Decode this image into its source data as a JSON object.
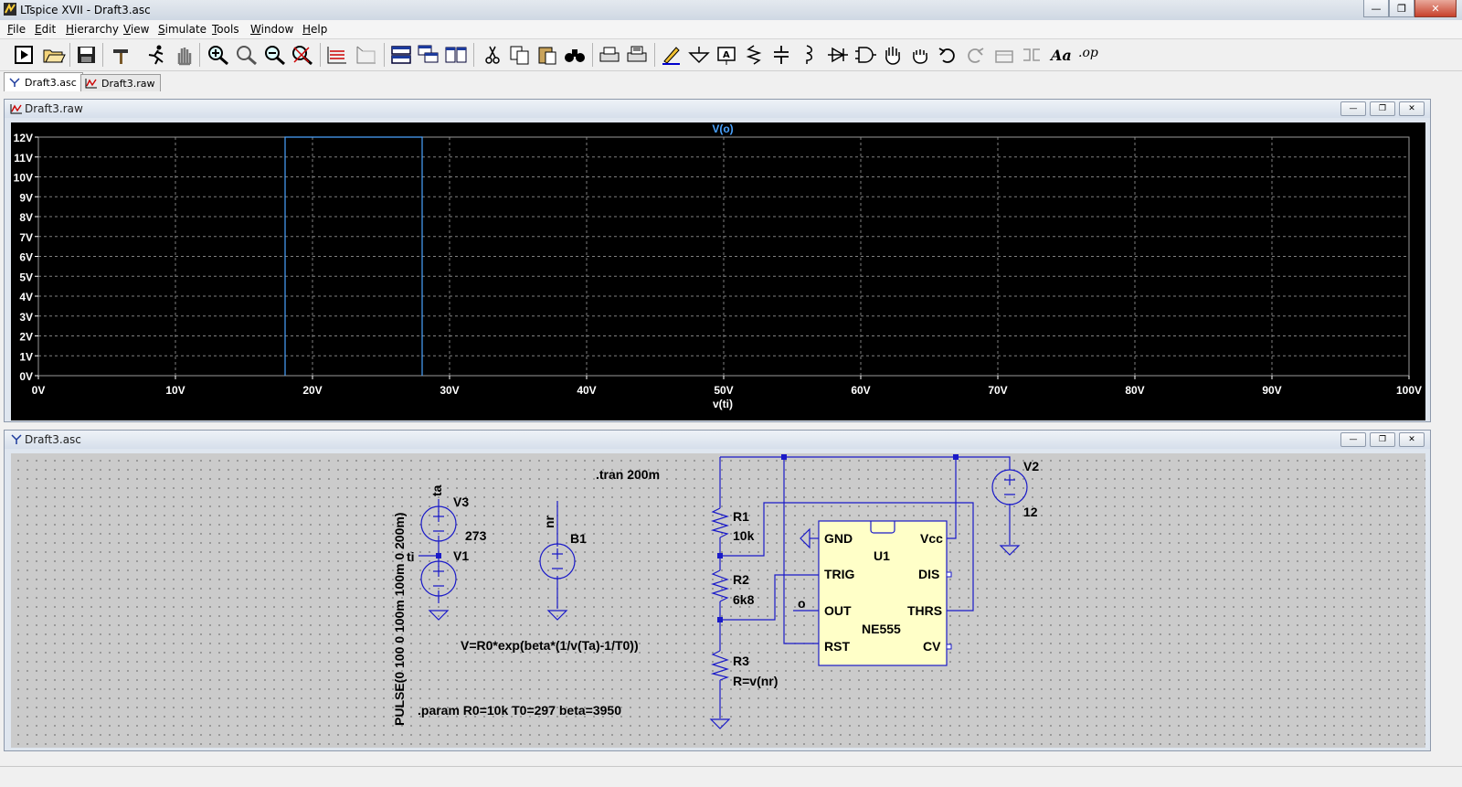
{
  "window": {
    "title": "LTspice XVII - Draft3.asc"
  },
  "menu": [
    "File",
    "Edit",
    "Hierarchy",
    "View",
    "Simulate",
    "Tools",
    "Window",
    "Help"
  ],
  "toolbar": {
    "op_label": ".op"
  },
  "tabs": [
    {
      "label": "Draft3.asc",
      "icon": "schematic-icon"
    },
    {
      "label": "Draft3.raw",
      "icon": "waveform-icon"
    }
  ],
  "waveform_window": {
    "title": "Draft3.raw",
    "trace_label": "V(o)",
    "x_axis_label": "v(ti)",
    "colors": {
      "background": "#000000",
      "trace": "#4aa3ff",
      "grid": "#7f7f7f",
      "labels": "#ffffff"
    }
  },
  "chart_data": {
    "type": "line",
    "title": "V(o)",
    "xlabel": "v(ti)",
    "ylabel": "",
    "xlim": [
      0,
      100
    ],
    "ylim": [
      0,
      12
    ],
    "x_ticks": [
      "0V",
      "10V",
      "20V",
      "30V",
      "40V",
      "50V",
      "60V",
      "70V",
      "80V",
      "90V",
      "100V"
    ],
    "y_ticks": [
      "0V",
      "1V",
      "2V",
      "3V",
      "4V",
      "5V",
      "6V",
      "7V",
      "8V",
      "9V",
      "10V",
      "11V",
      "12V"
    ],
    "grid": true,
    "series": [
      {
        "name": "V(o)",
        "x": [
          18,
          18,
          28,
          28
        ],
        "y": [
          0,
          12,
          12,
          0
        ]
      }
    ]
  },
  "schematic_window": {
    "title": "Draft3.asc",
    "labels": {
      "tran": ".tran 200m",
      "v3": "V3",
      "v3_value": "273",
      "net_ta": "ta",
      "net_ti": "ti",
      "v1": "V1",
      "v1_value": "PULSE(0 100 0 100m 100m 0 200m)",
      "b1": "B1",
      "net_nr": "nr",
      "b1_expr": "V=R0*exp(beta*(1/v(Ta)-1/T0))",
      "param": ".param R0=10k T0=297 beta=3950",
      "r1": "R1",
      "r1_value": "10k",
      "r2": "R2",
      "r2_value": "6k8",
      "r3": "R3",
      "r3_value": "R=v(nr)",
      "net_o": "o",
      "v2": "V2",
      "v2_value": "12",
      "u1": "U1",
      "u1_part": "NE555",
      "pin_gnd": "GND",
      "pin_vcc": "Vcc",
      "pin_trig": "TRIG",
      "pin_dis": "DIS",
      "pin_out": "OUT",
      "pin_thrs": "THRS",
      "pin_rst": "RST",
      "pin_cv": "CV"
    }
  }
}
